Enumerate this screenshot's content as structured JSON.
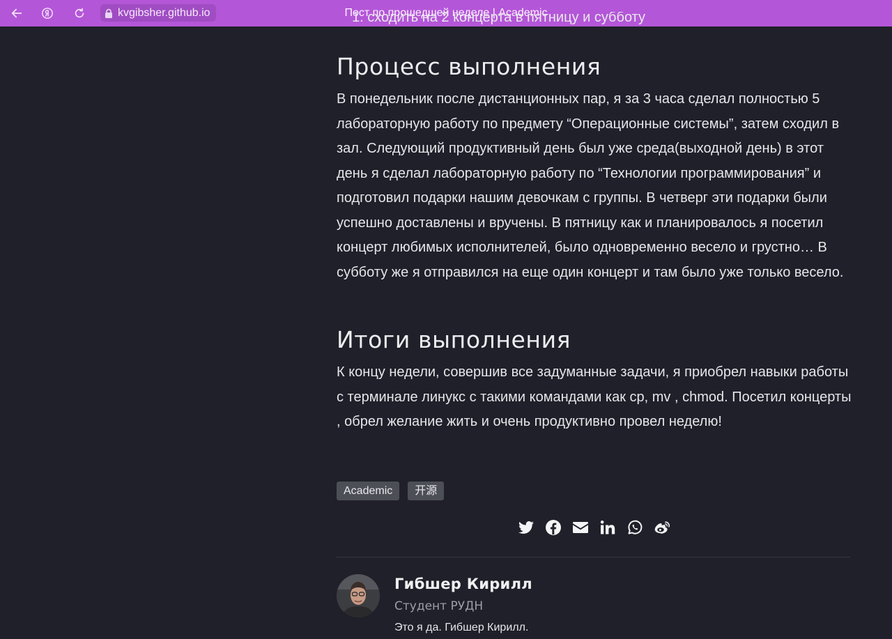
{
  "browser": {
    "url": "kvgibsher.github.io",
    "tab_title": "Пост по прошедшей неделе | Academic",
    "accent_color": "#b456d8",
    "icons": [
      "back-arrow-icon",
      "yandex-icon",
      "reload-icon",
      "lock-icon"
    ]
  },
  "article": {
    "previous_list_item": "1. сходить на 2 концерта в пятницу и субботу",
    "sections": [
      {
        "heading": "Процесс выполнения",
        "text": "В понедельник после дистанционных пар, я за 3 часа сделал полностью 5 лабораторную работу по предмету “Операционные системы”, затем сходил в зал. Следующий продуктивный день был уже среда(выходной день) в этот день я сделал лабораторную работу по “Технологии программирования” и подготовил подарки нашим девочкам с группы. В четверг эти подарки были успешно доставлены и вручены. В пятницу как и планировалось я посетил концерт любимых исполнителей, было одновременно весело и грустно… В субботу же я отправился на еще один концерт и там было уже только весело."
      },
      {
        "heading": "Итоги выполнения",
        "text": "К концу недели, совершив все задуманные задачи, я приобрел навыки работы с терминале линукс с такими командами как cp, mv , chmod. Посетил концерты , обрел желание жить и очень продуктивно провел неделю!"
      }
    ],
    "tags": [
      "Academic",
      "开源"
    ],
    "share_icons": [
      "twitter-icon",
      "facebook-icon",
      "email-icon",
      "linkedin-icon",
      "whatsapp-icon",
      "weibo-icon"
    ]
  },
  "author": {
    "name": "Гибшер Кирилл",
    "role": "Студент РУДН",
    "bio": "Это я да. Гибшер Кирилл."
  },
  "colors": {
    "background": "#1f2029",
    "tag_background": "#4d4f57",
    "muted_text": "#9d9ea6"
  }
}
